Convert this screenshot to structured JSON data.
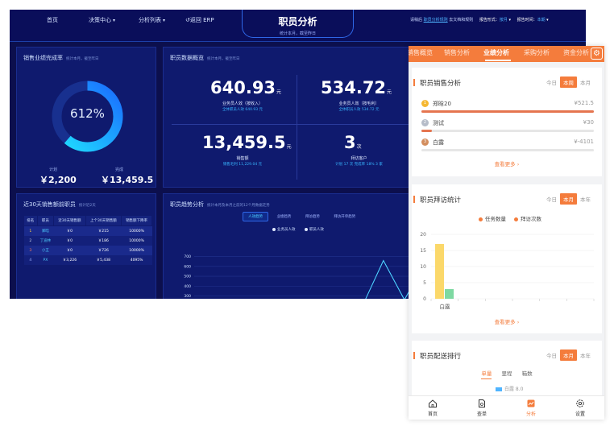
{
  "dashboard": {
    "nav": {
      "home": "首页",
      "decision": "决策中心",
      "analysis": "分析列表",
      "back": "返回 ERP"
    },
    "title": "职员分析",
    "subtitle": "统计本月，截至昨日",
    "top_right": {
      "prefix": "请稍后",
      "link": "职员分析规则",
      "rest": "去文档和规则",
      "report_label": "报告形式：",
      "report_value": "按月",
      "period_label": "报告时间：",
      "period_value": "本期"
    },
    "completion": {
      "title": "销售业绩完成率",
      "hint": "统计本月，截至昨日",
      "percent": 0.612,
      "percent_text": "612%",
      "plan_label": "计划",
      "plan_value": "￥2,200",
      "done_label": "完成",
      "done_value": "￥13,459.5"
    },
    "overview": {
      "title": "职员数据概览",
      "hint": "统计本月，截至昨日",
      "cells": [
        {
          "value": "640.93",
          "unit": "元",
          "label": "业务员人效（按收入）",
          "sub": "全体职员人效 640.93 元"
        },
        {
          "value": "534.72",
          "unit": "元",
          "label": "业务员人效（按毛利）",
          "sub": "全体职员人效 534.72 元"
        },
        {
          "value": "13,459.5",
          "unit": "元",
          "label": "销售额",
          "sub": "销售毛利 11,229.04 元"
        },
        {
          "value": "3",
          "unit": "次",
          "label": "拜访客户",
          "sub": "计划 17 次  完成率 18%  3 家"
        }
      ]
    },
    "table": {
      "title": "近30天销售额前职员",
      "hint": "统计近2天",
      "headers": [
        "排名",
        "职员",
        "近30天销售额",
        "上个30天销售额",
        "销售额下降率"
      ],
      "rows": [
        [
          "1",
          "郑晗",
          "￥0",
          "￥215",
          "10000%"
        ],
        [
          "2",
          "丁迪林",
          "￥0",
          "￥186",
          "10000%"
        ],
        [
          "3",
          "小王",
          "￥0",
          "￥726",
          "10000%"
        ],
        [
          "4",
          "PX",
          "￥3,226",
          "￥5,438",
          "4095%"
        ]
      ],
      "rank_colors": [
        "#ffd24a",
        "#c9d3e6",
        "#ff7b5c",
        "#9fb3ff"
      ]
    },
    "trend": {
      "title": "职员趋势分析",
      "hint": "统计本月及本月之前的12个月数据走势",
      "tabs": [
        "人效趋势",
        "业绩趋势",
        "拜访趋势",
        "拜访开单趋势"
      ],
      "legend": [
        "业务员人效",
        "职员人效"
      ]
    }
  },
  "chart_data": [
    {
      "type": "pie",
      "title": "销售业绩完成率",
      "values": [
        61.2,
        38.8
      ],
      "unit": "%"
    },
    {
      "type": "line",
      "title": "职员趋势分析",
      "yticks": [
        200,
        300,
        400,
        500,
        600,
        700
      ],
      "ylim": [
        200,
        720
      ],
      "series": [
        {
          "name": "业务员人效",
          "values": [
            200,
            200,
            200,
            200,
            200,
            200,
            200,
            200,
            200,
            660,
            265,
            640
          ]
        },
        {
          "name": "职员人效",
          "values": [
            200,
            200,
            200,
            200,
            200,
            200,
            200,
            200,
            200,
            658,
            262,
            638
          ]
        }
      ]
    },
    {
      "type": "bar",
      "title": "职员拜访统计",
      "categories": [
        "白露"
      ],
      "series": [
        {
          "name": "任务数量",
          "values": [
            17
          ]
        },
        {
          "name": "拜访次数",
          "values": [
            3
          ]
        }
      ],
      "yticks": [
        0,
        5,
        10,
        15,
        20
      ],
      "ylim": [
        0,
        20
      ]
    }
  ],
  "mobile": {
    "tabs": [
      "销售概览",
      "销售分析",
      "业绩分析",
      "采购分析",
      "资金分析"
    ],
    "sales_card": {
      "title": "职员销售分析",
      "seg": [
        "今日",
        "本周",
        "本月"
      ],
      "rows": [
        {
          "rank": "1",
          "name": "郑晗20",
          "value": "¥521.5",
          "ratio": 1.0,
          "color": "#f5b731"
        },
        {
          "rank": "2",
          "name": "测试",
          "value": "¥30",
          "ratio": 0.06,
          "color": "#b6bcc8"
        },
        {
          "rank": "3",
          "name": "白露",
          "value": "¥-4101",
          "ratio": 0.0,
          "color": "#d38e5e"
        }
      ],
      "more": "查看更多"
    },
    "visit_card": {
      "title": "职员拜访统计",
      "seg": [
        "今日",
        "本月",
        "本年"
      ],
      "legend": [
        "任务数量",
        "拜访次数"
      ],
      "more": "查看更多"
    },
    "delivery_card": {
      "title": "职员配送排行",
      "seg": [
        "今日",
        "本月",
        "本年"
      ],
      "subtabs": [
        "单量",
        "里程",
        "箱数"
      ],
      "peek": "白露 8.0"
    },
    "bottom_nav": [
      "首页",
      "查单",
      "分析",
      "设置"
    ]
  }
}
